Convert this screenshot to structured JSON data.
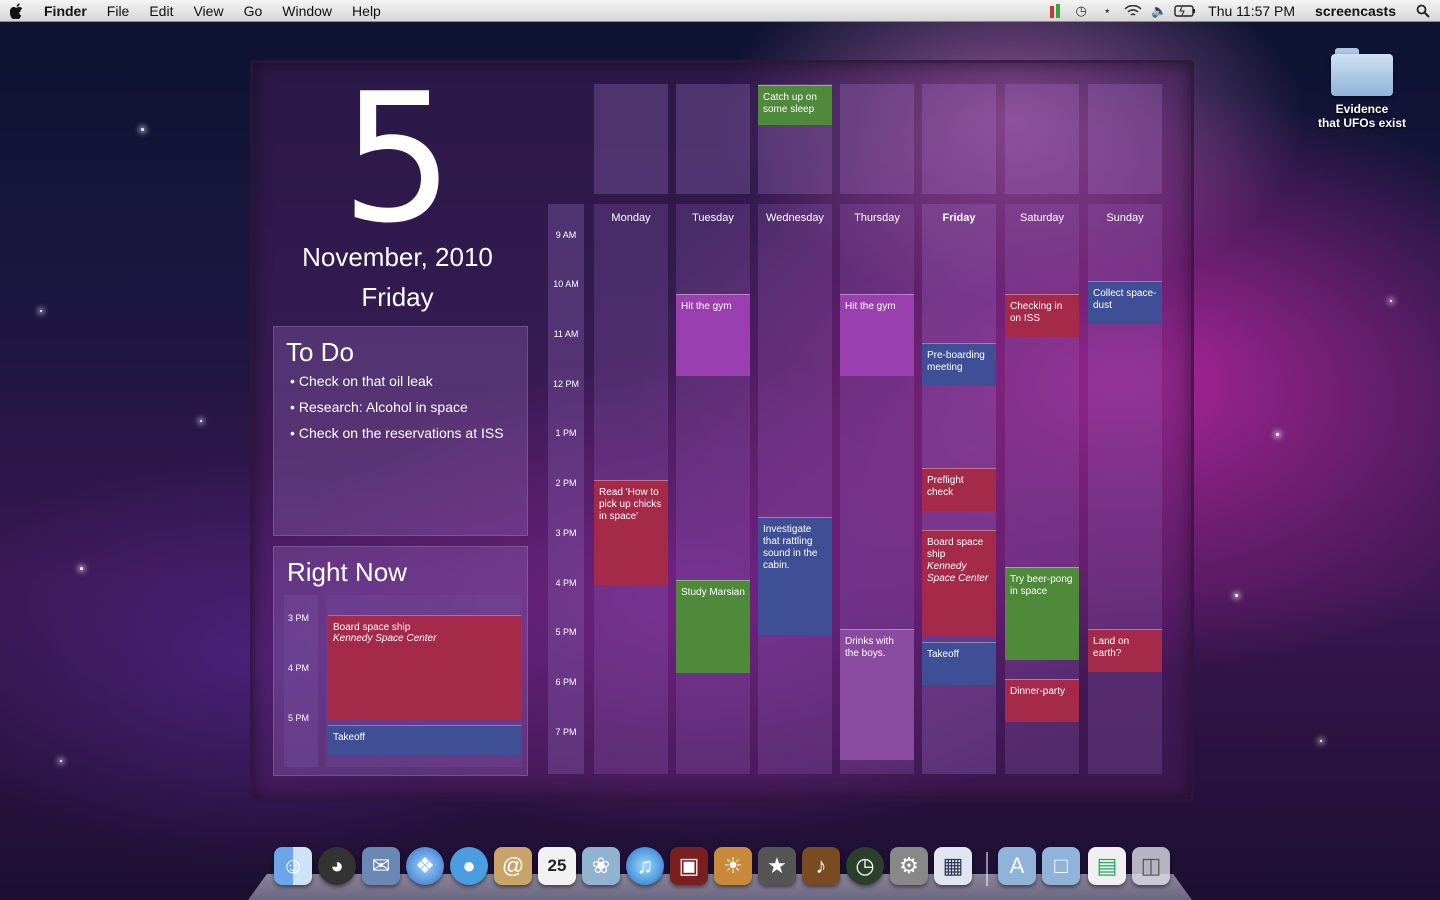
{
  "menubar": {
    "app_name": "Finder",
    "menus": [
      "File",
      "Edit",
      "View",
      "Go",
      "Window",
      "Help"
    ],
    "clock": "Thu 11:57 PM",
    "user": "screencasts",
    "status_icons": [
      "menu-meter-icon",
      "time-machine-icon",
      "bluetooth-icon",
      "wifi-icon",
      "volume-icon",
      "battery-icon"
    ]
  },
  "desktop": {
    "folder_label_line1": "Evidence",
    "folder_label_line2": "that UFOs exist"
  },
  "widget": {
    "day_number": "5",
    "month_year": "November, 2010",
    "weekday": "Friday",
    "todo": {
      "title": "To Do",
      "items": [
        "Check on that oil leak",
        "Research: Alcohol in space",
        "Check on the reservations at ISS"
      ]
    },
    "right_now": {
      "title": "Right Now",
      "hours": [
        "3 PM",
        "4 PM",
        "5 PM"
      ],
      "events": [
        {
          "title": "Board space ship",
          "location": "Kennedy Space Center"
        },
        {
          "title": "Takeoff"
        }
      ]
    }
  },
  "calendar": {
    "hours": [
      "9 AM",
      "10 AM",
      "11 AM",
      "12 PM",
      "1 PM",
      "2 PM",
      "3 PM",
      "4 PM",
      "5 PM",
      "6 PM",
      "7 PM"
    ],
    "days": [
      "Monday",
      "Tuesday",
      "Wednesday",
      "Thursday",
      "Friday",
      "Saturday",
      "Sunday"
    ],
    "current_day_index": 4,
    "allday_events": [
      {
        "day": "Wednesday",
        "title": "Catch up on some sleep"
      }
    ],
    "events": [
      {
        "day": "Monday",
        "title": "Read 'How to pick up chicks in space'"
      },
      {
        "day": "Tuesday",
        "title": "Hit the gym"
      },
      {
        "day": "Tuesday",
        "title": "Study Marsian"
      },
      {
        "day": "Wednesday",
        "title": "Investigate that rattling sound in the cabin."
      },
      {
        "day": "Thursday",
        "title": "Hit the gym"
      },
      {
        "day": "Thursday",
        "title": "Drinks with the boys."
      },
      {
        "day": "Friday",
        "title": "Pre-boarding meeting"
      },
      {
        "day": "Friday",
        "title": "Preflight check"
      },
      {
        "day": "Friday",
        "title": "Board space ship",
        "location": "Kennedy Space Center"
      },
      {
        "day": "Friday",
        "title": "Takeoff"
      },
      {
        "day": "Saturday",
        "title": "Checking in on ISS"
      },
      {
        "day": "Saturday",
        "title": "Try beer-pong in space"
      },
      {
        "day": "Saturday",
        "title": "Dinner-party"
      },
      {
        "day": "Sunday",
        "title": "Collect space-dust"
      },
      {
        "day": "Sunday",
        "title": "Land on earth?"
      }
    ],
    "colors": {
      "red": "#a52a4a",
      "purple": "#9a3fb0",
      "green": "#4e8a3a",
      "blue": "#3f4f95",
      "mauve": "#8a4aa0"
    }
  },
  "dock": {
    "apps": [
      "finder-icon",
      "dashboard-icon",
      "mail-icon",
      "safari-icon",
      "ichat-icon",
      "address-book-icon",
      "ical-icon",
      "iphoto-icon",
      "itunes-icon",
      "photo-booth-icon",
      "preview-icon",
      "imovie-icon",
      "garageband-icon",
      "time-machine-icon",
      "system-preferences-icon",
      "calendar-widget-icon"
    ],
    "calendar_icon_day": "25",
    "right_items": [
      "applications-folder-icon",
      "documents-folder-icon",
      "file-icon",
      "trash-icon"
    ]
  }
}
